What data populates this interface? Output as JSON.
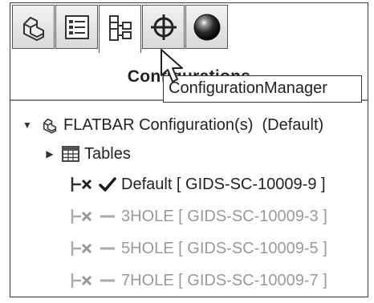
{
  "tabs": [
    {
      "name": "FeatureManager"
    },
    {
      "name": "PropertyManager"
    },
    {
      "name": "ConfigurationManager"
    },
    {
      "name": "DimXpertManager"
    },
    {
      "name": "DisplayManager"
    }
  ],
  "panel_title": "Configurations",
  "tooltip": "ConfigurationManager",
  "tree": {
    "root": {
      "label": "FLATBAR Configuration(s)  (Default)"
    },
    "tables": {
      "label": "Tables"
    },
    "configs": [
      {
        "label": "Default [ GIDS-SC-10009-9 ]",
        "active": true
      },
      {
        "label": "3HOLE [ GIDS-SC-10009-3 ]",
        "active": false
      },
      {
        "label": "5HOLE [ GIDS-SC-10009-5 ]",
        "active": false
      },
      {
        "label": "7HOLE [ GIDS-SC-10009-7 ]",
        "active": false
      }
    ]
  },
  "colors": {
    "border": "#3a3a3a",
    "check": "#1a1a1a",
    "dim_text": "#9a9a9a",
    "text": "#222222"
  }
}
